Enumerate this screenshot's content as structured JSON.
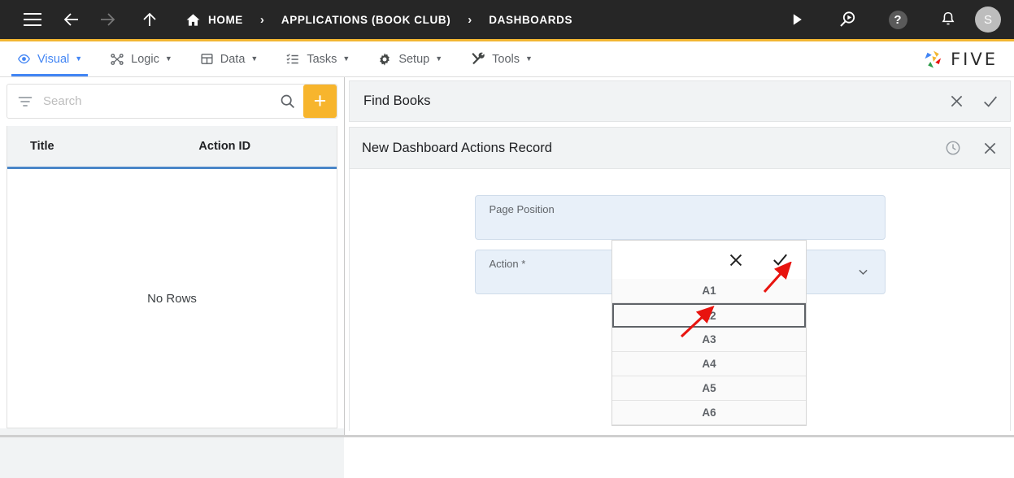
{
  "topbar": {
    "menu_icon": "hamburger-icon",
    "back_icon": "arrow-left-icon",
    "forward_icon": "arrow-right-icon",
    "up_icon": "arrow-up-icon",
    "breadcrumbs": [
      {
        "label": "HOME",
        "icon": "home-icon"
      },
      {
        "label": "APPLICATIONS (BOOK CLUB)",
        "icon": ""
      },
      {
        "label": "DASHBOARDS",
        "icon": ""
      }
    ],
    "separator": "›",
    "right_icons": [
      {
        "name": "run-play-icon",
        "glyph": "▶"
      },
      {
        "name": "search-debug-icon",
        "glyph": ""
      },
      {
        "name": "help-icon",
        "glyph": "?"
      },
      {
        "name": "notifications-bell-icon",
        "glyph": ""
      }
    ],
    "avatar_initial": "S",
    "accent_color": "#f2b632",
    "background_color": "#262626"
  },
  "menubar": {
    "items": [
      {
        "label": "Visual",
        "icon": "eye-icon",
        "active": true
      },
      {
        "label": "Logic",
        "icon": "flow-nodes-icon",
        "active": false
      },
      {
        "label": "Data",
        "icon": "table-grid-icon",
        "active": false
      },
      {
        "label": "Tasks",
        "icon": "checklist-icon",
        "active": false
      },
      {
        "label": "Setup",
        "icon": "gear-icon",
        "active": false
      },
      {
        "label": "Tools",
        "icon": "tools-wrench-screwdriver-icon",
        "active": false
      }
    ],
    "caret": "▼",
    "active_color": "#4285f4",
    "logo_text": "FIVE"
  },
  "left_panel": {
    "search": {
      "placeholder": "Search",
      "value": "",
      "filter_icon": "filter-icon",
      "search_icon": "search-icon"
    },
    "add_button_label": "+",
    "add_button_color": "#f7b52d",
    "grid": {
      "columns": [
        "Title",
        "Action ID"
      ],
      "empty_message": "No Rows",
      "header_accent_color": "#4a86c8"
    }
  },
  "main": {
    "find_books_panel": {
      "title": "Find Books",
      "close_icon": "close-x-icon",
      "confirm_icon": "check-icon"
    },
    "record_panel": {
      "title": "New Dashboard Actions Record",
      "history_icon": "clock-history-icon",
      "close_icon": "close-x-icon"
    },
    "fields": [
      {
        "label": "Page Position",
        "value": "",
        "type": "text"
      },
      {
        "label": "Action *",
        "value": "",
        "type": "select",
        "chevron_icon": "chevron-down-icon"
      }
    ]
  },
  "dropdown": {
    "close_icon": "close-x-icon",
    "confirm_icon": "check-icon",
    "options": [
      "A1",
      "A2",
      "A3",
      "A4",
      "A5",
      "A6"
    ],
    "selected": "A2"
  },
  "annotations": {
    "color": "#e8140f",
    "arrows": [
      {
        "name": "arrow-pointing-to-option-a2",
        "target": "A2"
      },
      {
        "name": "arrow-pointing-to-confirm-check",
        "target": "check-icon"
      }
    ]
  }
}
